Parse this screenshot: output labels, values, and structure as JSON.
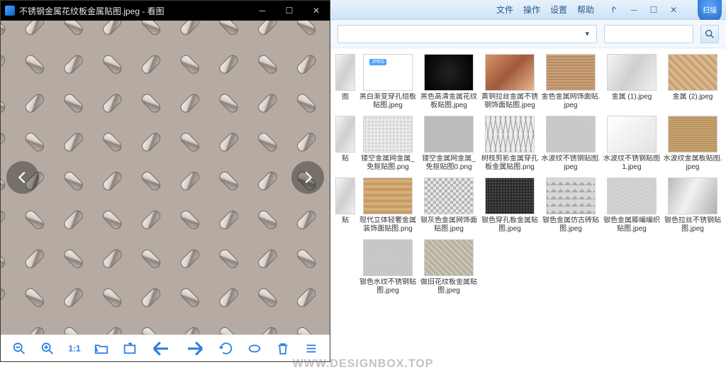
{
  "viewer": {
    "app_name": "看图",
    "title": "不锈钢金属花纹板金属贴图.jpeg - 看图",
    "toolbar": {
      "zoom_out": "缩小",
      "zoom_in": "放大",
      "one_to_one": "1:1",
      "open": "打开",
      "fullscreen": "全屏",
      "prev": "上一张",
      "next": "下一张",
      "rotate": "旋转",
      "loop": "循环",
      "delete": "删除",
      "more": "更多"
    }
  },
  "explorer": {
    "menu": {
      "file": "文件",
      "action": "操作",
      "settings": "设置",
      "help": "帮助"
    },
    "shield_label": "扫描",
    "search_placeholder": "",
    "rows": [
      [
        {
          "cap": "图",
          "thumb": "t-metal",
          "partial": true
        },
        {
          "cap": "黑白渐变穿孔组板贴图.jpeg",
          "thumb": "t-jpegicon"
        },
        {
          "cap": "黑色高清金属花纹板贴图.jpeg",
          "thumb": "t-dark"
        },
        {
          "cap": "黄铜拉丝金属不锈钢饰面贴图.jpeg",
          "thumb": "t-copper"
        },
        {
          "cap": "金色金属网饰面贴.jpeg",
          "thumb": "t-brush"
        },
        {
          "cap": "金属 (1).jpeg",
          "thumb": "t-metal"
        },
        {
          "cap": "金属 (2).jpeg",
          "thumb": "t-diamond2"
        }
      ],
      [
        {
          "cap": "贴",
          "thumb": "t-metal",
          "partial": true
        },
        {
          "cap": "镂空金属网金属_免抠贴图.png",
          "thumb": "t-dots"
        },
        {
          "cap": "镂空金属网金属_免抠贴图0.png",
          "thumb": "t-grid"
        },
        {
          "cap": "树枝剪影金属穿孔板金属贴图.png",
          "thumb": "t-branches"
        },
        {
          "cap": "水波纹不锈钢贴图.jpeg",
          "thumb": "t-noise"
        },
        {
          "cap": "水波纹不锈钢贴图1.jpeg",
          "thumb": "t-light"
        },
        {
          "cap": "水波纹金属板贴图.jpeg",
          "thumb": "t-anim"
        }
      ],
      [
        {
          "cap": "贴",
          "thumb": "t-metal",
          "partial": true
        },
        {
          "cap": "现代立体轻奢金属装饰面贴图.png",
          "thumb": "t-wood"
        },
        {
          "cap": "银灰色金属网饰面贴图.jpeg",
          "thumb": "t-lattice"
        },
        {
          "cap": "银色穿孔板金属贴图.jpeg",
          "thumb": "t-mesh"
        },
        {
          "cap": "银色金属仿古砖贴图.jpeg",
          "thumb": "t-pyramid"
        },
        {
          "cap": "银色金属藤编编织贴图.jpeg",
          "thumb": "t-fabric"
        },
        {
          "cap": "银色拉丝不锈钢贴图.jpeg",
          "thumb": "t-shiny"
        }
      ],
      [
        {
          "cap": "",
          "thumb": "",
          "partial": true
        },
        {
          "cap": "银色水纹不锈钢贴图.jpeg",
          "thumb": "t-stucco"
        },
        {
          "cap": "做旧花纹板金属贴图.jpeg",
          "thumb": "t-oldplate"
        }
      ]
    ]
  },
  "watermark": "WWW.DESIGNBOX.TOP"
}
